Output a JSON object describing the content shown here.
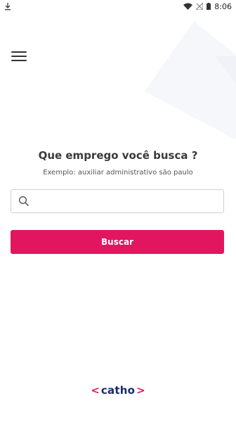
{
  "status_bar": {
    "time": "8:06",
    "icons": [
      "download-icon",
      "wifi-icon",
      "no-signal-icon",
      "battery-icon"
    ]
  },
  "header": {
    "menu_icon": "hamburger-menu-icon"
  },
  "main": {
    "headline": "Que emprego você busca ?",
    "example": "Exemplo: auxiliar administrativo são paulo",
    "search": {
      "placeholder": "",
      "value": ""
    },
    "search_button_label": "Buscar"
  },
  "footer": {
    "logo_left": "<",
    "logo_text": "catho",
    "logo_right": ">"
  },
  "colors": {
    "accent": "#e2165e",
    "brand_text": "#1b2a6b"
  }
}
